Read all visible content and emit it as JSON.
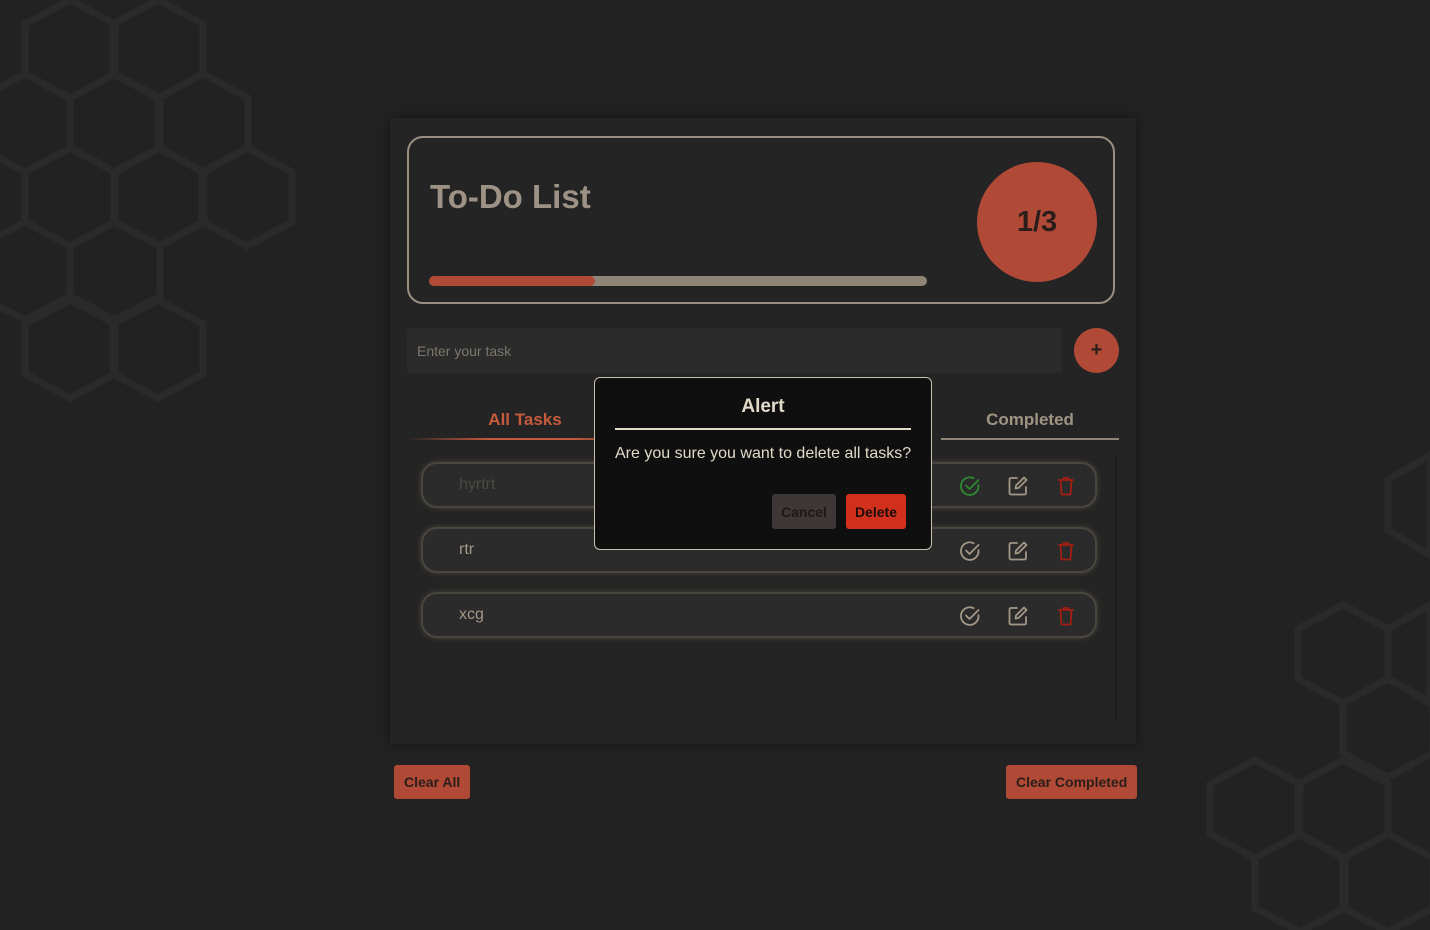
{
  "app": {
    "title": "To-Do List",
    "counter": "1/3",
    "progress_fraction": 0.333
  },
  "input": {
    "placeholder": "Enter your task",
    "value": "",
    "add_label": "+"
  },
  "tabs": [
    {
      "label": "All Tasks",
      "active": true
    },
    {
      "label": "Completed",
      "active": false
    }
  ],
  "tasks": [
    {
      "text": "hyrtrt",
      "completed": true
    },
    {
      "text": "rtr",
      "completed": false
    },
    {
      "text": "xcg",
      "completed": false
    }
  ],
  "footer": {
    "clear_all_label": "Clear All",
    "clear_completed_label": "Clear Completed"
  },
  "modal": {
    "title": "Alert",
    "message": "Are you sure you want to delete all tasks?",
    "cancel_label": "Cancel",
    "delete_label": "Delete"
  },
  "icons": {
    "complete": "check-circle-icon",
    "edit": "edit-icon",
    "delete": "trash-icon",
    "add": "plus-icon"
  },
  "colors": {
    "background": "#222222",
    "accent": "#b04a36",
    "tab_active": "#c65a3d",
    "muted_text": "#9d9285",
    "task_text": "#a39888",
    "completed_task_text": "#4d4a45",
    "completed_check": "#2e8a2e",
    "delete_icon": "#a41e12",
    "modal_delete": "#d0301c"
  }
}
